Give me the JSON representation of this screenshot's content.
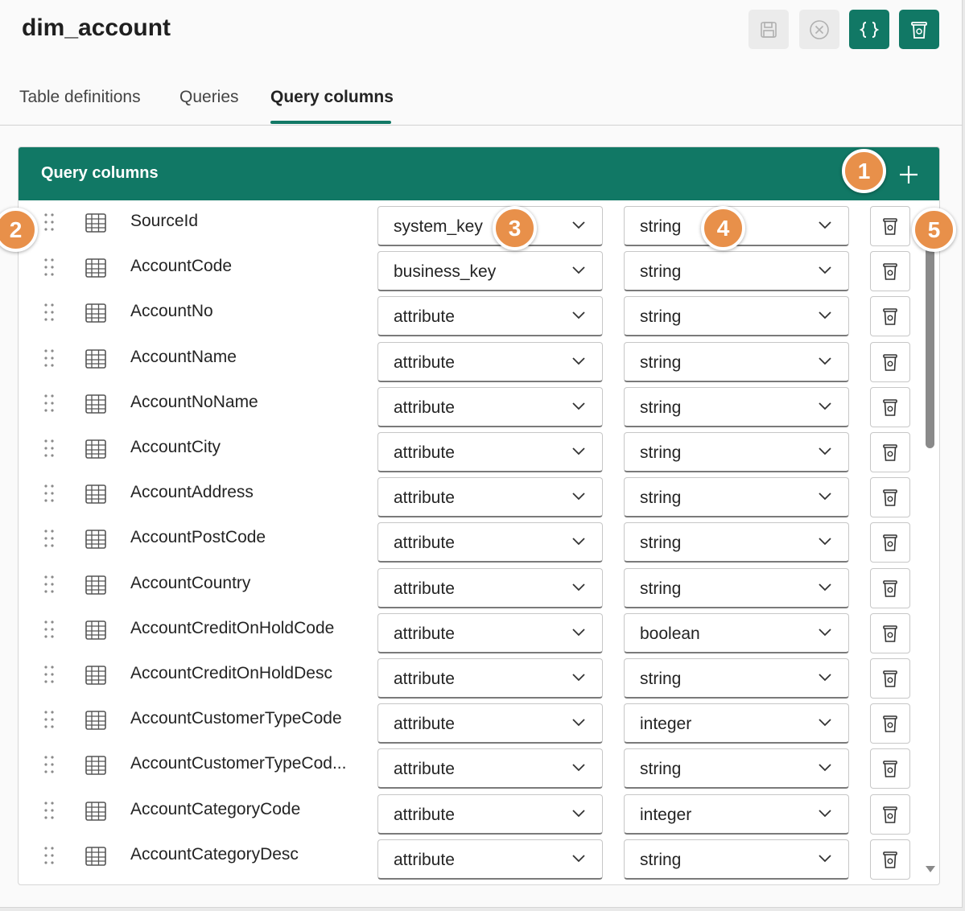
{
  "window": {
    "title": "dim_account"
  },
  "toolbar": {
    "buttons": [
      {
        "name": "save-button",
        "icon": "save-icon",
        "enabled": false
      },
      {
        "name": "discard-button",
        "icon": "close-circle-icon",
        "enabled": false
      },
      {
        "name": "json-button",
        "icon": "braces-icon",
        "enabled": true
      },
      {
        "name": "delete-table-button",
        "icon": "trash-icon",
        "enabled": true
      }
    ]
  },
  "tabs": [
    {
      "label": "Table definitions",
      "active": false
    },
    {
      "label": "Queries",
      "active": false
    },
    {
      "label": "Query columns",
      "active": true
    }
  ],
  "card": {
    "title": "Query columns",
    "add_icon": "plus-icon"
  },
  "columns": [
    {
      "name": "SourceId",
      "role": "system_key",
      "type": "string"
    },
    {
      "name": "AccountCode",
      "role": "business_key",
      "type": "string"
    },
    {
      "name": "AccountNo",
      "role": "attribute",
      "type": "string"
    },
    {
      "name": "AccountName",
      "role": "attribute",
      "type": "string"
    },
    {
      "name": "AccountNoName",
      "role": "attribute",
      "type": "string"
    },
    {
      "name": "AccountCity",
      "role": "attribute",
      "type": "string"
    },
    {
      "name": "AccountAddress",
      "role": "attribute",
      "type": "string"
    },
    {
      "name": "AccountPostCode",
      "role": "attribute",
      "type": "string"
    },
    {
      "name": "AccountCountry",
      "role": "attribute",
      "type": "string"
    },
    {
      "name": "AccountCreditOnHoldCode",
      "role": "attribute",
      "type": "boolean"
    },
    {
      "name": "AccountCreditOnHoldDesc",
      "role": "attribute",
      "type": "string"
    },
    {
      "name": "AccountCustomerTypeCode",
      "role": "attribute",
      "type": "integer"
    },
    {
      "name": "AccountCustomerTypeCod...",
      "role": "attribute",
      "type": "string"
    },
    {
      "name": "AccountCategoryCode",
      "role": "attribute",
      "type": "integer"
    },
    {
      "name": "AccountCategoryDesc",
      "role": "attribute",
      "type": "string"
    }
  ],
  "callouts": [
    "1",
    "2",
    "3",
    "4",
    "5"
  ],
  "colors": {
    "accent": "#117865",
    "callout": "#e8904a",
    "disabled": "#ebebeb"
  }
}
